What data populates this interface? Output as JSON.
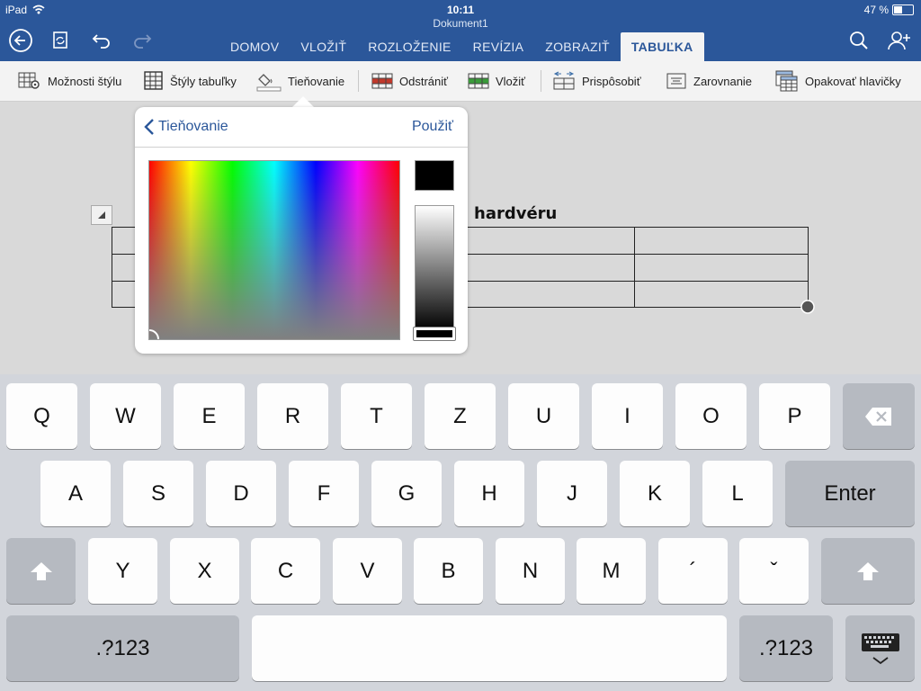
{
  "status": {
    "device": "iPad",
    "time": "10:11",
    "battery": "47 %"
  },
  "document": {
    "name": "Dokument1",
    "heading": "hardvéru"
  },
  "tabs": [
    {
      "label": "DOMOV",
      "active": false
    },
    {
      "label": "VLOŽIŤ",
      "active": false
    },
    {
      "label": "ROZLOŽENIE",
      "active": false
    },
    {
      "label": "REVÍZIA",
      "active": false
    },
    {
      "label": "ZOBRAZIŤ",
      "active": false
    },
    {
      "label": "TABUĽKA",
      "active": true
    }
  ],
  "ribbon": {
    "style_options": "Možnosti štýlu",
    "table_styles": "Štýly tabuľky",
    "shading": "Tieňovanie",
    "delete": "Odstrániť",
    "insert": "Vložiť",
    "fit": "Prispôsobiť",
    "align": "Zarovnanie",
    "repeat_headers": "Opakovať hlavičky"
  },
  "popover": {
    "back_label": "Tieňovanie",
    "apply_label": "Použiť",
    "selected_color": "#000000"
  },
  "keyboard": {
    "row1": [
      "Q",
      "W",
      "E",
      "R",
      "T",
      "Z",
      "U",
      "I",
      "O",
      "P"
    ],
    "row2": [
      "A",
      "S",
      "D",
      "F",
      "G",
      "H",
      "J",
      "K",
      "L"
    ],
    "row3": [
      "Y",
      "X",
      "C",
      "V",
      "B",
      "N",
      "M",
      "´",
      "ˇ"
    ],
    "enter": "Enter",
    "numbers": ".?123"
  },
  "colors": {
    "titlebar": "#2b579a",
    "accent": "#2b579a"
  }
}
